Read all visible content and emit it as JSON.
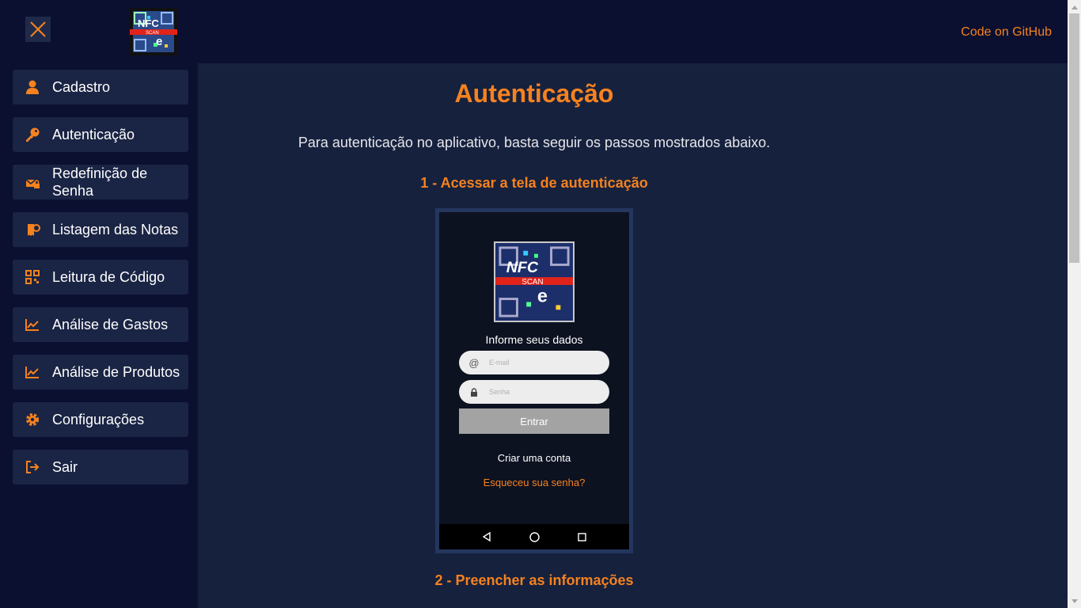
{
  "header": {
    "github_link": "Code on GitHub",
    "close_icon": "close-x-icon",
    "logo": {
      "top_text": "NFC",
      "mid_text": "SCAN",
      "letter": "e"
    }
  },
  "sidebar": {
    "items": [
      {
        "label": "Cadastro",
        "icon": "user-icon"
      },
      {
        "label": "Autenticação",
        "icon": "key-icon"
      },
      {
        "label": "Redefinição de Senha",
        "icon": "mail-lock-icon"
      },
      {
        "label": "Listagem das Notas",
        "icon": "receipt-icon"
      },
      {
        "label": "Leitura de Código",
        "icon": "qr-code-icon"
      },
      {
        "label": "Análise de Gastos",
        "icon": "chart-line-icon"
      },
      {
        "label": "Análise de Produtos",
        "icon": "chart-line-icon"
      },
      {
        "label": "Configurações",
        "icon": "gear-icon"
      },
      {
        "label": "Sair",
        "icon": "logout-icon"
      }
    ]
  },
  "main": {
    "title": "Autenticação",
    "intro": "Para autenticação no aplicativo, basta seguir os passos mostrados abaixo.",
    "steps": [
      {
        "title": "1 - Acessar a tela de autenticação"
      },
      {
        "title": "2 - Preencher as informações"
      }
    ],
    "phone": {
      "prompt": "Informe seus dados",
      "email_placeholder": "E-mail",
      "password_placeholder": "Senha",
      "submit_label": "Entrar",
      "create_account": "Criar uma conta",
      "forgot_password": "Esqueceu sua senha?"
    }
  },
  "colors": {
    "accent": "#f5821f",
    "sidebar_bg": "#0b1030",
    "main_bg": "#16213e",
    "nav_item_bg": "#1a2444"
  }
}
